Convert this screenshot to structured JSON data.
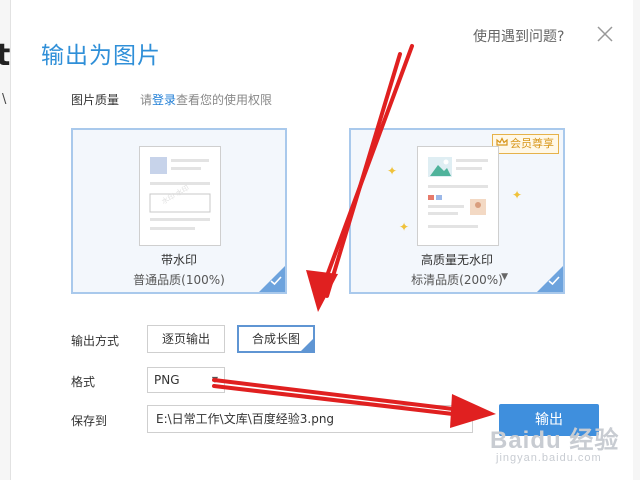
{
  "background": {
    "partial_text": "t",
    "partial_text2": "\\"
  },
  "dialog": {
    "title": "输出为图片",
    "help_link": "使用遇到问题?",
    "close_icon": "close-icon"
  },
  "quality": {
    "label": "图片质量",
    "hint_prefix": "请",
    "hint_link": "登录",
    "hint_suffix": "查看您的使用权限",
    "options": [
      {
        "name": "带水印",
        "sub": "普通品质(100%)",
        "selected": true
      },
      {
        "name": "高质量无水印",
        "sub": "标清品质(200%)",
        "badge": "会员尊享",
        "selected": true
      }
    ]
  },
  "output_mode": {
    "label": "输出方式",
    "options": [
      "逐页输出",
      "合成长图"
    ],
    "selected": "合成长图"
  },
  "format": {
    "label": "格式",
    "value": "PNG"
  },
  "save_to": {
    "label": "保存到",
    "path": "E:\\日常工作\\文库\\百度经验3.png",
    "browse": "..."
  },
  "export_button": {
    "label": "输出"
  },
  "watermark": {
    "main": "Baidu 经验",
    "sub": "jingyan.baidu.com"
  },
  "colors": {
    "accent": "#2f8fd8",
    "button": "#3f8fdd",
    "arrow": "#e02020",
    "badge": "#d8961a"
  }
}
